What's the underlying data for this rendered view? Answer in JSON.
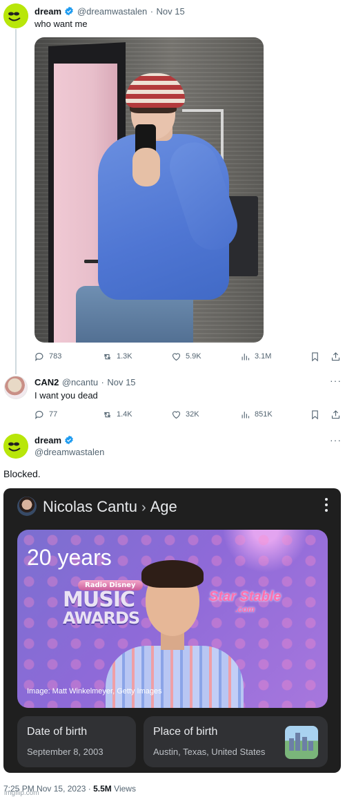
{
  "tweet1": {
    "name": "dream",
    "handle": "@dreamwastalen",
    "date": "Nov 15",
    "text": "who want me",
    "stats": {
      "replies": "783",
      "retweets": "1.3K",
      "likes": "5.9K",
      "views": "3.1M"
    }
  },
  "tweet2": {
    "name": "CAN2",
    "handle": "@ncantu",
    "date": "Nov 15",
    "text": "I want you dead",
    "stats": {
      "replies": "77",
      "retweets": "1.4K",
      "likes": "32K",
      "views": "851K"
    }
  },
  "tweet3": {
    "name": "dream",
    "handle": "@dreamwastalen",
    "text": "Blocked."
  },
  "panel": {
    "subject": "Nicolas Cantu",
    "separator": "›",
    "attribute": "Age",
    "age": "20 years",
    "image_credit": "Image: Matt Winkelmeyer, Getty Images",
    "logo_radio": "Radio Disney",
    "logo_music": "MUSIC",
    "logo_awards": "AWARDS",
    "logo_star": "Star Stable",
    "logo_com": ".com",
    "dob_label": "Date of birth",
    "dob_value": "September 8, 2003",
    "pob_label": "Place of birth",
    "pob_value": "Austin, Texas, United States"
  },
  "footer": {
    "time": "7:25 PM",
    "date": "Nov 15, 2023",
    "views_count": "5.5M",
    "views_label": "Views"
  },
  "watermark": "imgflip.com",
  "colors": {
    "verified": "#1d9bf0",
    "dream_avatar": "#b8e60a",
    "panel_bg": "#1f1f1f",
    "thread_line": "#cfd9de"
  }
}
